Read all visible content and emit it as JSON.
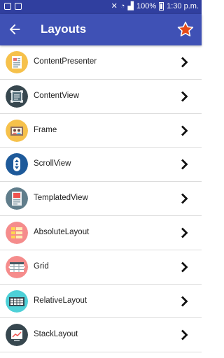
{
  "statusbar": {
    "battery": "100%",
    "time": "1:30 p.m."
  },
  "toolbar": {
    "title": "Layouts"
  },
  "items": [
    {
      "label": "ContentPresenter",
      "icon": "document-icon",
      "color": "#f6c14b"
    },
    {
      "label": "ContentView",
      "icon": "viewfinder-icon",
      "color": "#37474f"
    },
    {
      "label": "Frame",
      "icon": "photo-frame-icon",
      "color": "#f6c14b"
    },
    {
      "label": "ScrollView",
      "icon": "scroll-icon",
      "color": "#1e5a9a"
    },
    {
      "label": "TemplatedView",
      "icon": "template-icon",
      "color": "#607d8b"
    },
    {
      "label": "AbsoluteLayout",
      "icon": "absolute-grid-icon",
      "color": "#f58c8c"
    },
    {
      "label": "Grid",
      "icon": "grid-icon",
      "color": "#f58c8c"
    },
    {
      "label": "RelativeLayout",
      "icon": "relative-grid-icon",
      "color": "#4dd0d7"
    },
    {
      "label": "StackLayout",
      "icon": "stack-chart-icon",
      "color": "#37474f"
    }
  ]
}
